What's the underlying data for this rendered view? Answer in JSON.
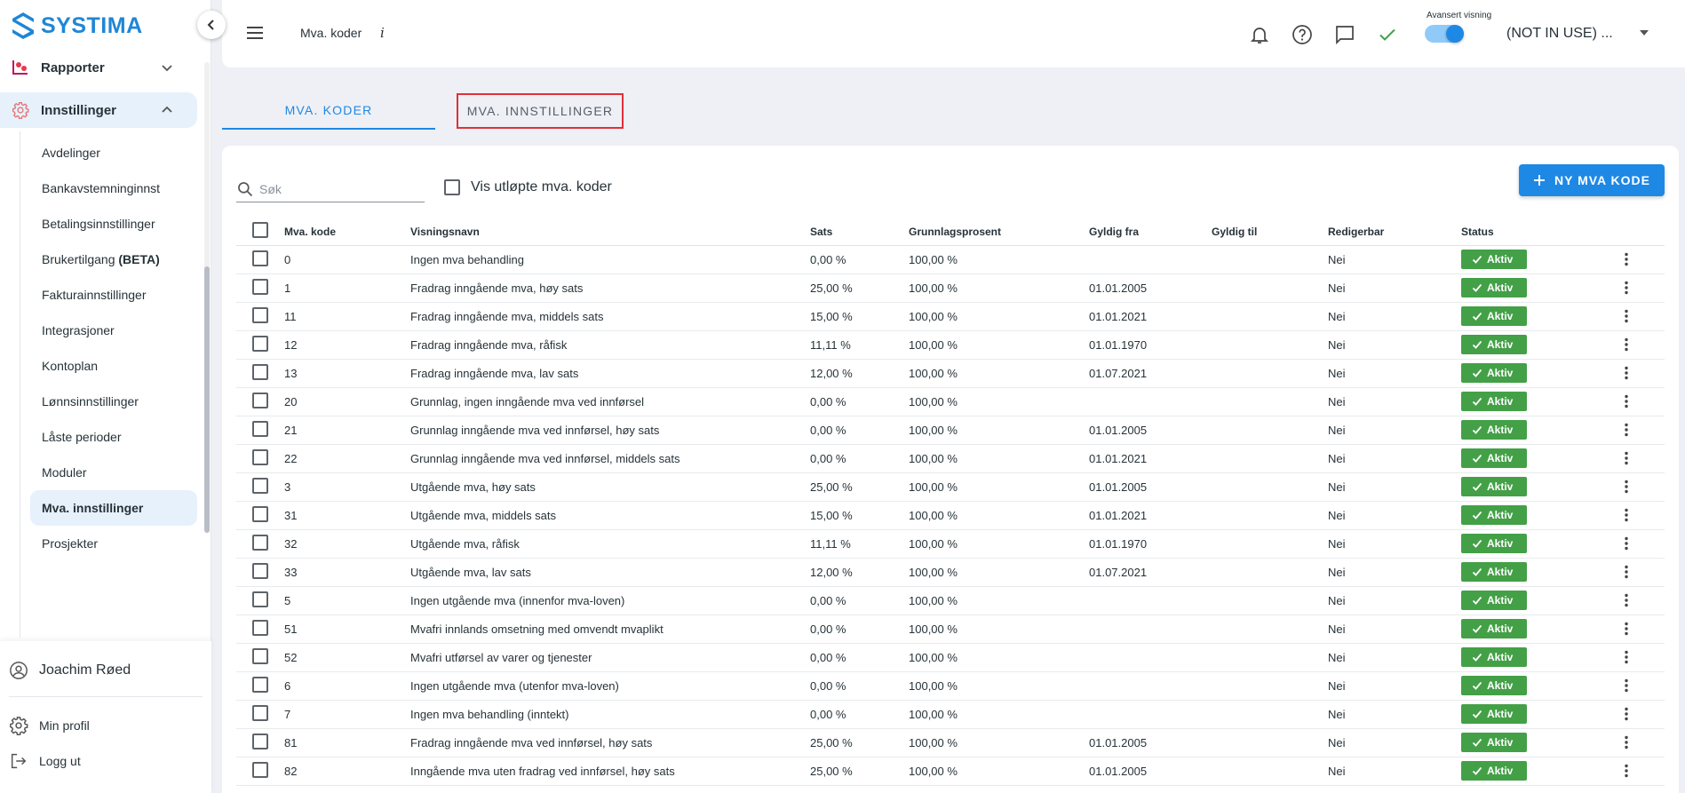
{
  "brand": {
    "name": "SYSTIMA",
    "color": "#1f86d6"
  },
  "sidebar": {
    "groups": [
      {
        "label": "Rapporter",
        "icon": "report-icon",
        "expanded": false
      },
      {
        "label": "Innstillinger",
        "icon": "gear-icon",
        "expanded": true
      }
    ],
    "items": [
      {
        "label": "Avdelinger"
      },
      {
        "label": "Bankavstemninginnst"
      },
      {
        "label": "Betalingsinnstillinger"
      },
      {
        "label": "Brukertilgang",
        "suffix": "(BETA)"
      },
      {
        "label": "Fakturainnstillinger"
      },
      {
        "label": "Integrasjoner"
      },
      {
        "label": "Kontoplan"
      },
      {
        "label": "Lønnsinnstillinger"
      },
      {
        "label": "Låste perioder"
      },
      {
        "label": "Moduler"
      },
      {
        "label": "Mva. innstillinger",
        "active": true
      },
      {
        "label": "Prosjekter"
      }
    ],
    "user": {
      "name": "Joachim Røed"
    },
    "profile_label": "Min profil",
    "logout_label": "Logg ut"
  },
  "header": {
    "breadcrumb": "Mva. koder",
    "info_glyph": "i",
    "advanced_view_label": "Avansert visning",
    "advanced_view_on": true,
    "company": "(NOT IN USE) ..."
  },
  "tabs": [
    {
      "label": "MVA. KODER",
      "active": true
    },
    {
      "label": "MVA. INNSTILLINGER",
      "active": false
    }
  ],
  "toolbar": {
    "search_placeholder": "Søk",
    "show_expired_label": "Vis utløpte mva. koder",
    "new_button_label": "NY MVA KODE"
  },
  "table": {
    "columns": [
      "Mva. kode",
      "Visningsnavn",
      "Sats",
      "Grunnlagsprosent",
      "Gyldig fra",
      "Gyldig til",
      "Redigerbar",
      "Status"
    ],
    "rows": [
      [
        "0",
        "Ingen mva behandling",
        "0,00 %",
        "100,00 %",
        "",
        "",
        "Nei",
        "Aktiv"
      ],
      [
        "1",
        "Fradrag inngående mva, høy sats",
        "25,00 %",
        "100,00 %",
        "01.01.2005",
        "",
        "Nei",
        "Aktiv"
      ],
      [
        "11",
        "Fradrag inngående mva, middels sats",
        "15,00 %",
        "100,00 %",
        "01.01.2021",
        "",
        "Nei",
        "Aktiv"
      ],
      [
        "12",
        "Fradrag inngående mva, råfisk",
        "11,11 %",
        "100,00 %",
        "01.01.1970",
        "",
        "Nei",
        "Aktiv"
      ],
      [
        "13",
        "Fradrag inngående mva, lav sats",
        "12,00 %",
        "100,00 %",
        "01.07.2021",
        "",
        "Nei",
        "Aktiv"
      ],
      [
        "20",
        "Grunnlag, ingen inngående mva ved innførsel",
        "0,00 %",
        "100,00 %",
        "",
        "",
        "Nei",
        "Aktiv"
      ],
      [
        "21",
        "Grunnlag inngående mva ved innførsel, høy sats",
        "0,00 %",
        "100,00 %",
        "01.01.2005",
        "",
        "Nei",
        "Aktiv"
      ],
      [
        "22",
        "Grunnlag inngående mva ved innførsel, middels sats",
        "0,00 %",
        "100,00 %",
        "01.01.2021",
        "",
        "Nei",
        "Aktiv"
      ],
      [
        "3",
        "Utgående mva, høy sats",
        "25,00 %",
        "100,00 %",
        "01.01.2005",
        "",
        "Nei",
        "Aktiv"
      ],
      [
        "31",
        "Utgående mva, middels sats",
        "15,00 %",
        "100,00 %",
        "01.01.2021",
        "",
        "Nei",
        "Aktiv"
      ],
      [
        "32",
        "Utgående mva, råfisk",
        "11,11 %",
        "100,00 %",
        "01.01.1970",
        "",
        "Nei",
        "Aktiv"
      ],
      [
        "33",
        "Utgående mva, lav sats",
        "12,00 %",
        "100,00 %",
        "01.07.2021",
        "",
        "Nei",
        "Aktiv"
      ],
      [
        "5",
        "Ingen utgående mva (innenfor mva-loven)",
        "0,00 %",
        "100,00 %",
        "",
        "",
        "Nei",
        "Aktiv"
      ],
      [
        "51",
        "Mvafri innlands omsetning med omvendt mvaplikt",
        "0,00 %",
        "100,00 %",
        "",
        "",
        "Nei",
        "Aktiv"
      ],
      [
        "52",
        "Mvafri utførsel av varer og tjenester",
        "0,00 %",
        "100,00 %",
        "",
        "",
        "Nei",
        "Aktiv"
      ],
      [
        "6",
        "Ingen utgående mva (utenfor mva-loven)",
        "0,00 %",
        "100,00 %",
        "",
        "",
        "Nei",
        "Aktiv"
      ],
      [
        "7",
        "Ingen mva behandling (inntekt)",
        "0,00 %",
        "100,00 %",
        "",
        "",
        "Nei",
        "Aktiv"
      ],
      [
        "81",
        "Fradrag inngående mva ved innførsel, høy sats",
        "25,00 %",
        "100,00 %",
        "01.01.2005",
        "",
        "Nei",
        "Aktiv"
      ],
      [
        "82",
        "Inngående mva uten fradrag ved innførsel, høy sats",
        "25,00 %",
        "100,00 %",
        "01.01.2005",
        "",
        "Nei",
        "Aktiv"
      ]
    ]
  },
  "colors": {
    "primary": "#1e88e5",
    "status_active": "#43a047",
    "highlight_border": "#e0303a",
    "active_nav_bg": "#e6f1fc"
  }
}
